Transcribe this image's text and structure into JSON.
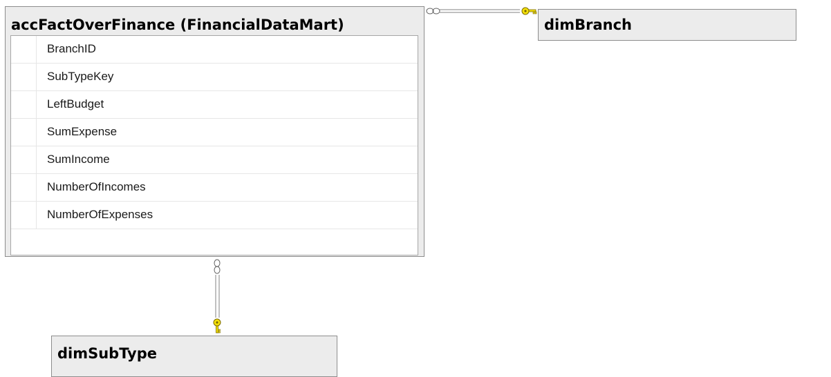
{
  "fact_table": {
    "title": "accFactOverFinance (FinancialDataMart)",
    "columns": [
      "BranchID",
      "SubTypeKey",
      "LeftBudget",
      "SumExpense",
      "SumIncome",
      "NumberOfIncomes",
      "NumberOfExpenses"
    ]
  },
  "branch_table": {
    "title": "dimBranch"
  },
  "subtype_table": {
    "title": "dimSubType"
  },
  "colors": {
    "table_background": "#ececec",
    "grid_background": "#ffffff",
    "connector": "#808080",
    "key_icon": "#f5e10a"
  }
}
